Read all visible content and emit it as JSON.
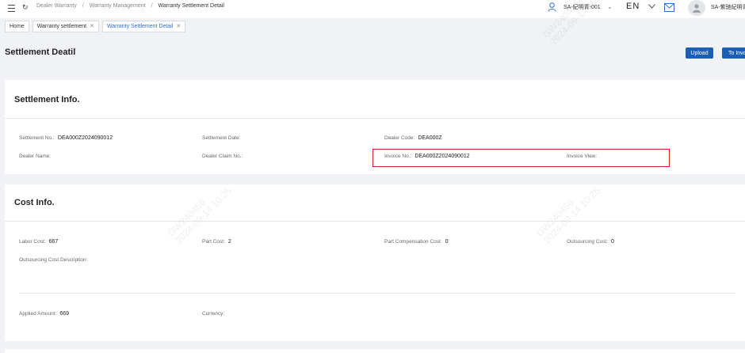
{
  "topbar": {
    "breadcrumbs": [
      "Dealer Warranty",
      "Warranty Management",
      "Warranty Settlement Detail"
    ],
    "account": "SA-紀明青-001",
    "language": "EN",
    "username": "SA-紫驰紀明青"
  },
  "tabs": [
    {
      "label": "Home",
      "closable": false,
      "active": false
    },
    {
      "label": "Warranty settlement",
      "closable": true,
      "active": false
    },
    {
      "label": "Warranty Settlement Detail",
      "closable": true,
      "active": true
    }
  ],
  "page": {
    "title": "Settlement Deatil",
    "upload_label": "Upload",
    "invoice_label": "To Invoice"
  },
  "settlement": {
    "title": "Settlement Info.",
    "settlement_no_label": "Settlement No.:",
    "settlement_no": "DEA000Z2024090012",
    "settlement_date_label": "Settlement Date:",
    "settlement_date": "",
    "dealer_code_label": "Dealer Code:",
    "dealer_code": "DEA000Z",
    "dealer_name_label": "Dealer Name:",
    "dealer_name": "",
    "dealer_claim_no_label": "Dealer Claim No.:",
    "dealer_claim_no": "",
    "invoice_no_label": "Invoice No.:",
    "invoice_no": "DEA000Z2024090012",
    "invoice_view_label": "Invoice View:"
  },
  "cost": {
    "title": "Cost Info.",
    "labor_cost_label": "Labor Cost:",
    "labor_cost": "667",
    "part_cost_label": "Part Cost:",
    "part_cost": "2",
    "part_comp_label": "Part Compensation Cost:",
    "part_comp": "0",
    "outsourcing_cost_label": "Outsourcing Cost:",
    "outsourcing_cost": "0",
    "outsourcing_desc_label": "Outsourcing Cost Description:",
    "applied_amount_label": "Applied Amount:",
    "applied_amount": "669",
    "currency_label": "Currency:",
    "currency": ""
  },
  "watermark": {
    "line1": "GW240456",
    "line2": "2024-09-14 10:25"
  },
  "colors": {
    "primary": "#1a5fb4",
    "highlight": "#e02020",
    "active_tab": "#2f6fd6"
  }
}
